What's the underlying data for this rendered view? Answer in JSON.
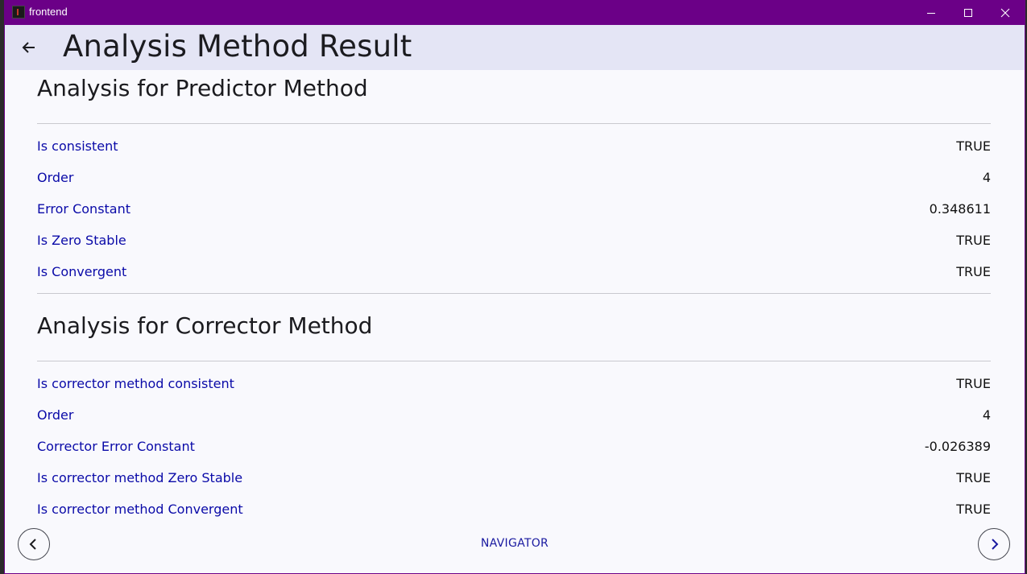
{
  "window": {
    "title": "frontend"
  },
  "appbar": {
    "title": "Analysis Method Result",
    "back_icon": "arrow-left-icon"
  },
  "predictor": {
    "title": "Analysis for Predictor Method",
    "rows": [
      {
        "label": "Is consistent",
        "value": "TRUE"
      },
      {
        "label": "Order",
        "value": "4"
      },
      {
        "label": "Error Constant",
        "value": "0.348611"
      },
      {
        "label": "Is Zero Stable",
        "value": "TRUE"
      },
      {
        "label": "Is Convergent",
        "value": "TRUE"
      }
    ]
  },
  "corrector": {
    "title": "Analysis for Corrector Method",
    "rows": [
      {
        "label": "Is corrector method consistent",
        "value": "TRUE"
      },
      {
        "label": "Order",
        "value": "4"
      },
      {
        "label": "Corrector Error Constant",
        "value": "-0.026389"
      },
      {
        "label": "Is corrector method Zero Stable",
        "value": "TRUE"
      },
      {
        "label": "Is corrector method Convergent",
        "value": "TRUE"
      }
    ]
  },
  "navigator": {
    "label": "NAVIGATOR",
    "prev_icon": "chevron-left-icon",
    "next_icon": "chevron-right-icon"
  },
  "colors": {
    "titlebar": "#6b0087",
    "appbar": "#e4e5f5",
    "label": "#0a0aa8",
    "background": "#f9f9fd"
  }
}
